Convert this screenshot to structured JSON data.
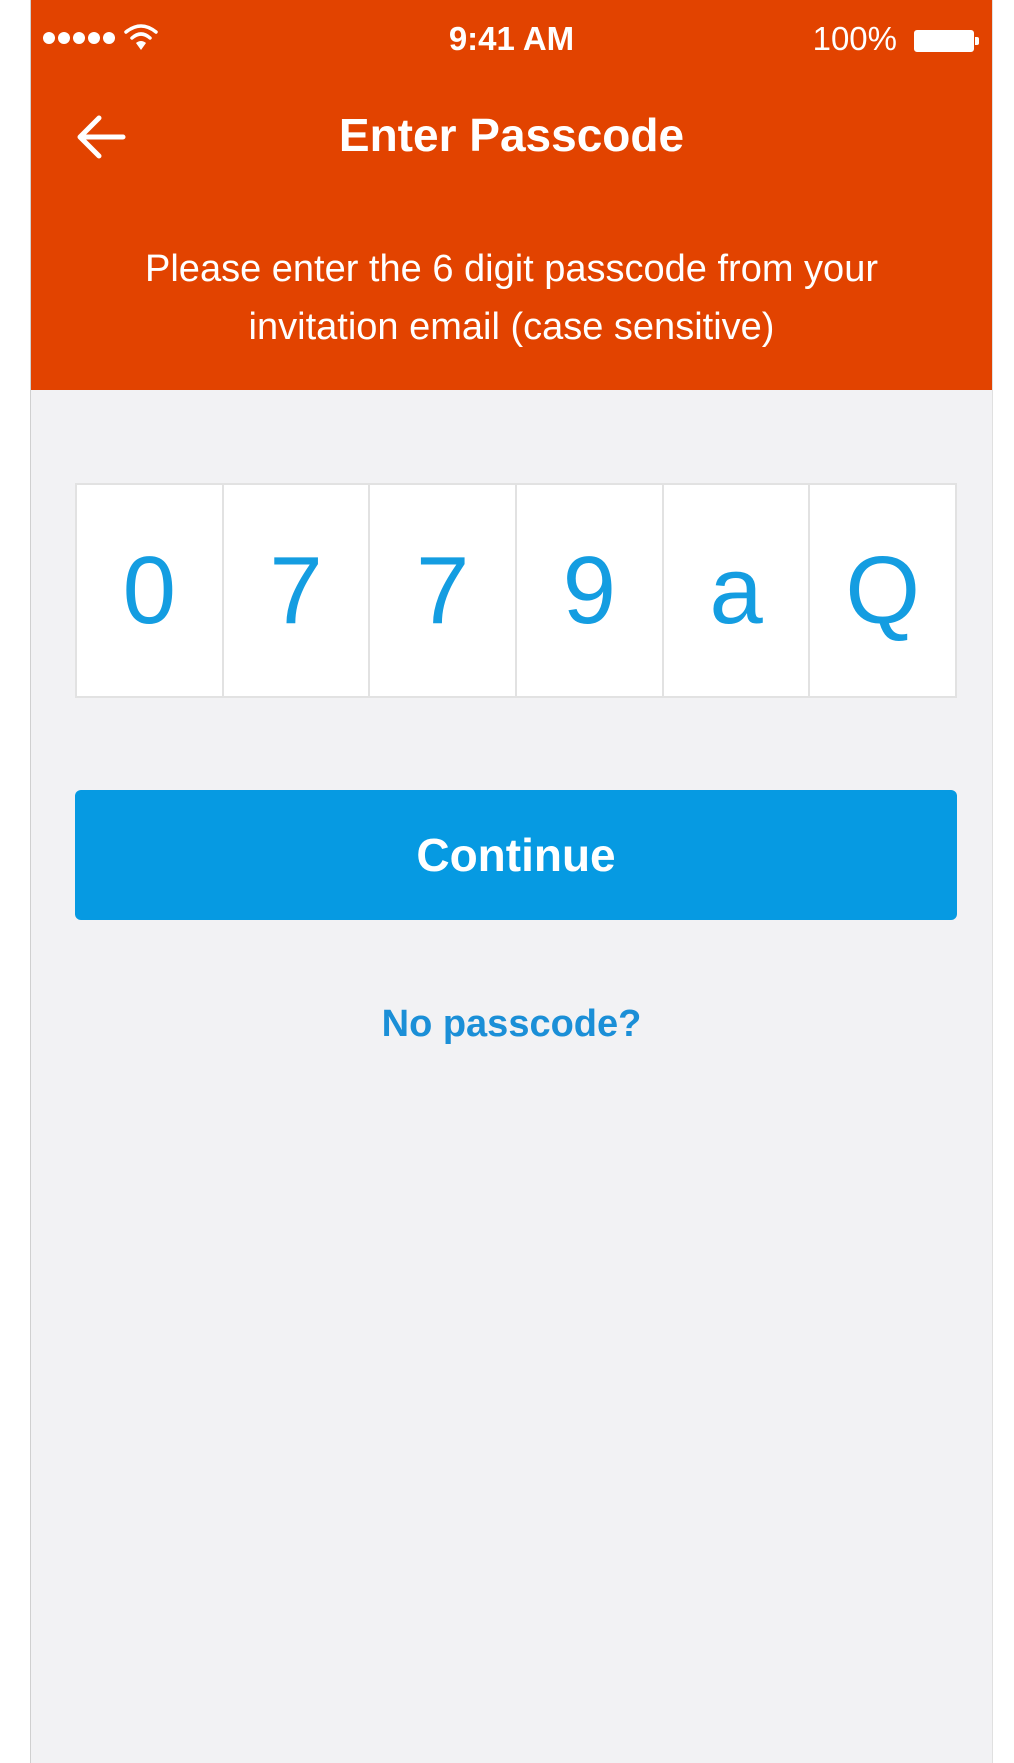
{
  "status_bar": {
    "time": "9:41 AM",
    "battery_percent": "100%",
    "signal_bars": 5,
    "icons": [
      "signal-dots-icon",
      "wifi-icon",
      "battery-icon"
    ]
  },
  "header": {
    "back_icon": "arrow-left-icon",
    "title": "Enter Passcode",
    "instructions": "Please enter the 6 digit passcode from your invitation email (case sensitive)"
  },
  "passcode": {
    "digits": [
      "0",
      "7",
      "7",
      "9",
      "a",
      "Q"
    ]
  },
  "actions": {
    "continue_label": "Continue",
    "no_passcode_label": "No passcode?"
  },
  "colors": {
    "header_background": "#e24300",
    "accent_blue": "#069ae2",
    "digit_text": "#149de1",
    "screen_background": "#f2f2f4"
  }
}
